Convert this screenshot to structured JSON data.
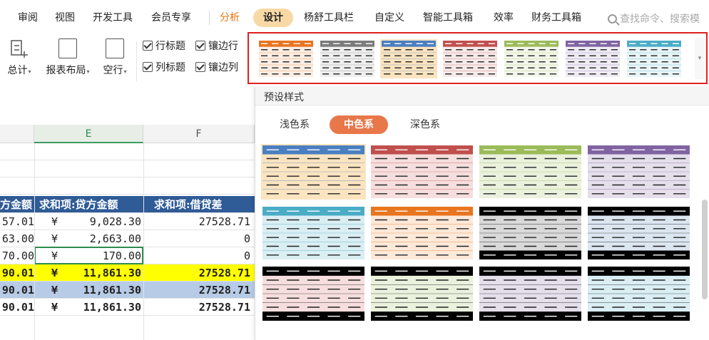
{
  "menubar": {
    "tabs": [
      "审阅",
      "视图",
      "开发工具",
      "会员专享",
      "分析",
      "设计",
      "杨舒工具栏",
      "自定义",
      "智能工具箱",
      "效率",
      "财务工具箱"
    ],
    "search_placeholder": "查找命令、搜索模"
  },
  "ribbon": {
    "subtotal": "总计",
    "report_layout": "报表布局",
    "blank_rows": "空行",
    "row_headers": "行标题",
    "banded_rows": "镶边行",
    "col_headers": "列标题",
    "banded_cols": "镶边列"
  },
  "gallery_colors": [
    "#e8751f",
    "#7b7b7b",
    "#4a7fc1",
    "#c0504d",
    "#9bbb59",
    "#8064a2",
    "#4bacc6"
  ],
  "sheet": {
    "columns": [
      "E",
      "F"
    ],
    "header": [
      "方金额",
      "求和项:贷方金额",
      "求和项:借贷差"
    ],
    "rows": [
      [
        "57.01",
        "¥",
        "9,028.30",
        "27528.71"
      ],
      [
        "63.00",
        "¥",
        "2,663.00",
        "0"
      ],
      [
        "70.00",
        "¥",
        "170.00",
        "0"
      ],
      [
        "90.01",
        "¥",
        "11,861.30",
        "27528.71"
      ],
      [
        "90.01",
        "¥",
        "11,861.30",
        "27528.71"
      ],
      [
        "90.01",
        "¥",
        "11,861.30",
        "27528.71"
      ]
    ]
  },
  "panel": {
    "title": "预设样式",
    "tabs": [
      "浅色系",
      "中色系",
      "深色系"
    ],
    "active_tab": "中色系",
    "row1_colors": [
      "#4a7fc1",
      "#c0504d",
      "#9bbb59",
      "#8064a2"
    ],
    "row2_colors": [
      "#4bacc6",
      "#e8751f",
      "#000000",
      "#000000"
    ],
    "row3_colors": [
      "#000000",
      "#000000",
      "#000000",
      "#000000"
    ]
  }
}
